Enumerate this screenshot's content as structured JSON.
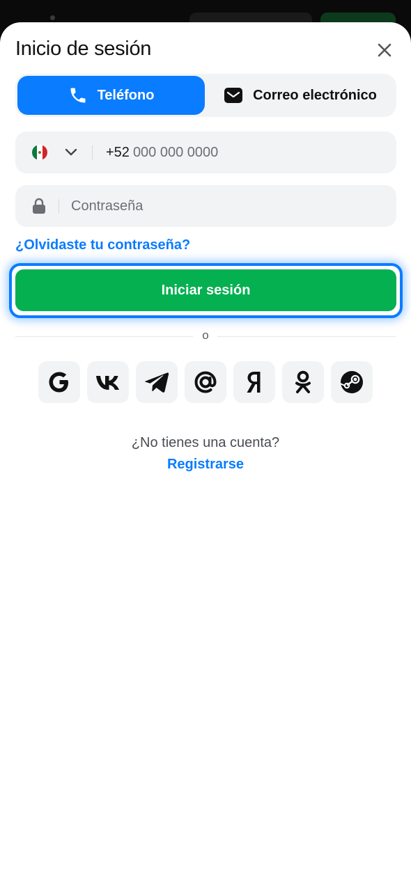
{
  "header": {
    "title": "Inicio de sesión"
  },
  "tabs": [
    {
      "label": "Teléfono",
      "icon": "phone-icon",
      "active": true
    },
    {
      "label": "Correo electrónico",
      "icon": "mail-icon",
      "active": false
    }
  ],
  "phone_field": {
    "country_flag": "mexico-flag-icon",
    "code": "+52",
    "placeholder": "000 000 0000"
  },
  "password_field": {
    "placeholder": "Contraseña",
    "icon": "lock-icon"
  },
  "forgot_label": "¿Olvidaste tu contraseña?",
  "login_label": "Iniciar sesión",
  "divider_label": "o",
  "social_logins": [
    "google-icon",
    "vk-icon",
    "telegram-icon",
    "mail-ru-icon",
    "yandex-icon",
    "odnoklassniki-icon",
    "steam-icon"
  ],
  "signup": {
    "prompt": "¿No tienes una cuenta?",
    "link": "Registrarse"
  },
  "colors": {
    "accent": "#0a7cff",
    "primary": "#04b050",
    "field_bg": "#f2f3f5",
    "text": "#111111"
  }
}
